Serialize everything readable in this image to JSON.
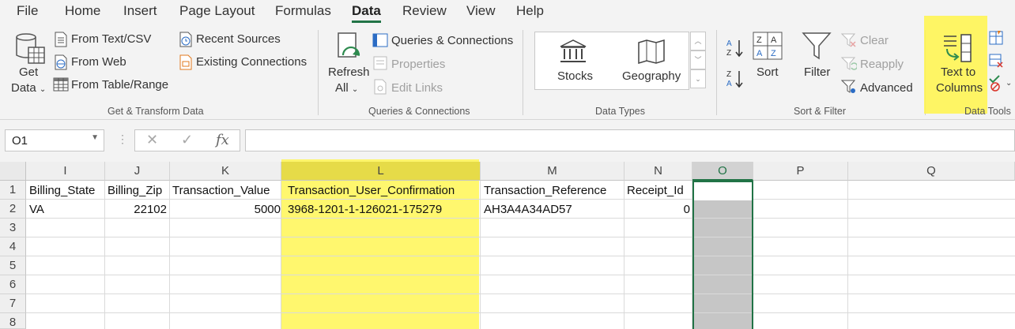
{
  "menu": {
    "tabs": [
      "File",
      "Home",
      "Insert",
      "Page Layout",
      "Formulas",
      "Data",
      "Review",
      "View",
      "Help"
    ],
    "active": "Data"
  },
  "ribbon": {
    "get_transform": {
      "get_data_line1": "Get",
      "get_data_line2": "Data",
      "from_text_csv": "From Text/CSV",
      "from_web": "From Web",
      "from_table_range": "From Table/Range",
      "recent_sources": "Recent Sources",
      "existing_connections": "Existing Connections",
      "group_label": "Get & Transform Data"
    },
    "queries": {
      "refresh_line1": "Refresh",
      "refresh_line2": "All",
      "queries_connections": "Queries & Connections",
      "properties": "Properties",
      "edit_links": "Edit Links",
      "group_label": "Queries & Connections"
    },
    "data_types": {
      "stocks": "Stocks",
      "geography": "Geography",
      "group_label": "Data Types"
    },
    "sort_filter": {
      "sort": "Sort",
      "filter": "Filter",
      "clear": "Clear",
      "reapply": "Reapply",
      "advanced": "Advanced",
      "group_label": "Sort & Filter"
    },
    "data_tools": {
      "text_to_columns_line1": "Text to",
      "text_to_columns_line2": "Columns",
      "group_label": "Data Tools"
    }
  },
  "formula_bar": {
    "name_box": "O1",
    "fx": "fx",
    "cancel": "✕",
    "enter": "✓",
    "value": ""
  },
  "sheet": {
    "columns": [
      "I",
      "J",
      "K",
      "L",
      "M",
      "N",
      "O",
      "P",
      "Q"
    ],
    "selected_column": "O",
    "rows": [
      "1",
      "2",
      "3",
      "4",
      "5",
      "6",
      "7",
      "8"
    ],
    "row1": {
      "I": "Billing_State",
      "J": "Billing_Zip",
      "K": "Transaction_Value",
      "L": "Transaction_User_Confirmation",
      "M": "Transaction_Reference",
      "N": "Receipt_Id"
    },
    "row2": {
      "I": "VA",
      "J": "22102",
      "K": "5000",
      "L": "3968-1201-1-126021-175279",
      "M": "AH3A4A34AD57",
      "N": "0"
    }
  },
  "colors": {
    "highlight": "#fff54a",
    "excel_green": "#217346",
    "selection_gray": "#c6c6c6"
  }
}
